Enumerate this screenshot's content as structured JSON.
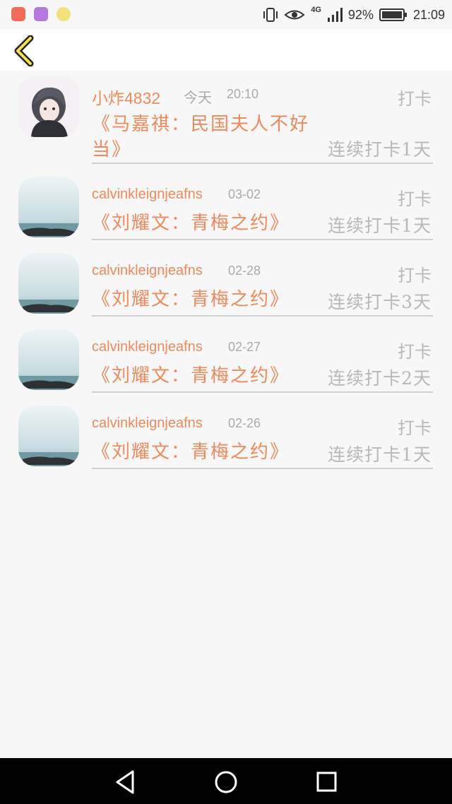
{
  "status_bar": {
    "network": "4G",
    "battery": "92%",
    "time": "21:09"
  },
  "header": {
    "back_icon": "chevron-left-icon"
  },
  "records": [
    {
      "name": "小炸4832",
      "day": "今天",
      "time": "20:10",
      "action": "打卡",
      "title": "《马嘉祺：民国夫人不好当》",
      "streak": "连续打卡1天"
    },
    {
      "name": "calvinkleignjeafns",
      "time": "03-02",
      "action": "打卡",
      "title": "《刘耀文：青梅之约》",
      "streak": "连续打卡1天"
    },
    {
      "name": "calvinkleignjeafns",
      "time": "02-28",
      "action": "打卡",
      "title": "《刘耀文：青梅之约》",
      "streak": "连续打卡3天"
    },
    {
      "name": "calvinkleignjeafns",
      "time": "02-27",
      "action": "打卡",
      "title": "《刘耀文：青梅之约》",
      "streak": "连续打卡2天"
    },
    {
      "name": "calvinkleignjeafns",
      "time": "02-26",
      "action": "打卡",
      "title": "《刘耀文：青梅之约》",
      "streak": "连续打卡1天"
    }
  ],
  "colors": {
    "accent": "#f08a5b",
    "muted": "#b8b8b8"
  }
}
